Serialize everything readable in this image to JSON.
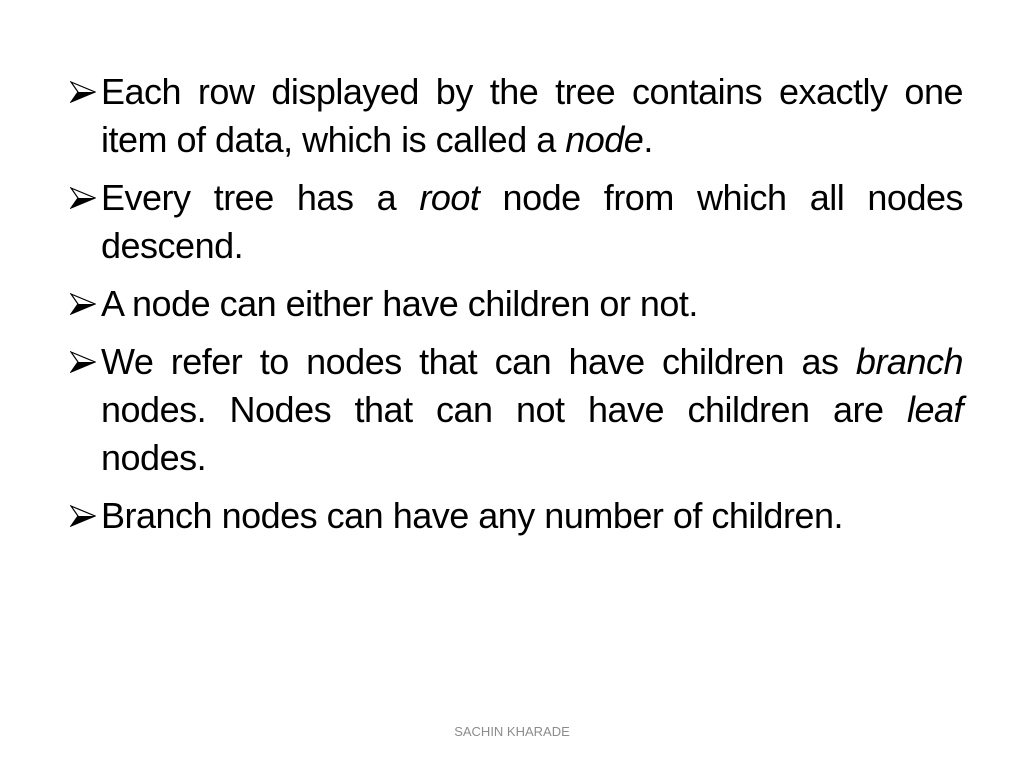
{
  "slide": {
    "bullets": [
      {
        "parts": [
          {
            "text": "Each row displayed by the tree contains exactly one item of data, which is called a "
          },
          {
            "text": "node",
            "italic": true
          },
          {
            "text": "."
          }
        ]
      },
      {
        "parts": [
          {
            "text": " Every tree has a "
          },
          {
            "text": "root",
            "italic": true
          },
          {
            "text": " node from which all nodes descend."
          }
        ]
      },
      {
        "parts": [
          {
            "text": "A node can either have children or not."
          }
        ]
      },
      {
        "parts": [
          {
            "text": "We refer to nodes that can have children as "
          },
          {
            "text": "branch",
            "italic": true
          },
          {
            "text": " nodes. Nodes that can not have children are "
          },
          {
            "text": "leaf",
            "italic": true
          },
          {
            "text": " nodes."
          }
        ]
      },
      {
        "parts": [
          {
            "text": "Branch nodes can have any number of children."
          }
        ]
      }
    ],
    "bullet_icon": "arrowhead-bullet-icon",
    "footer": "SACHIN KHARADE"
  }
}
